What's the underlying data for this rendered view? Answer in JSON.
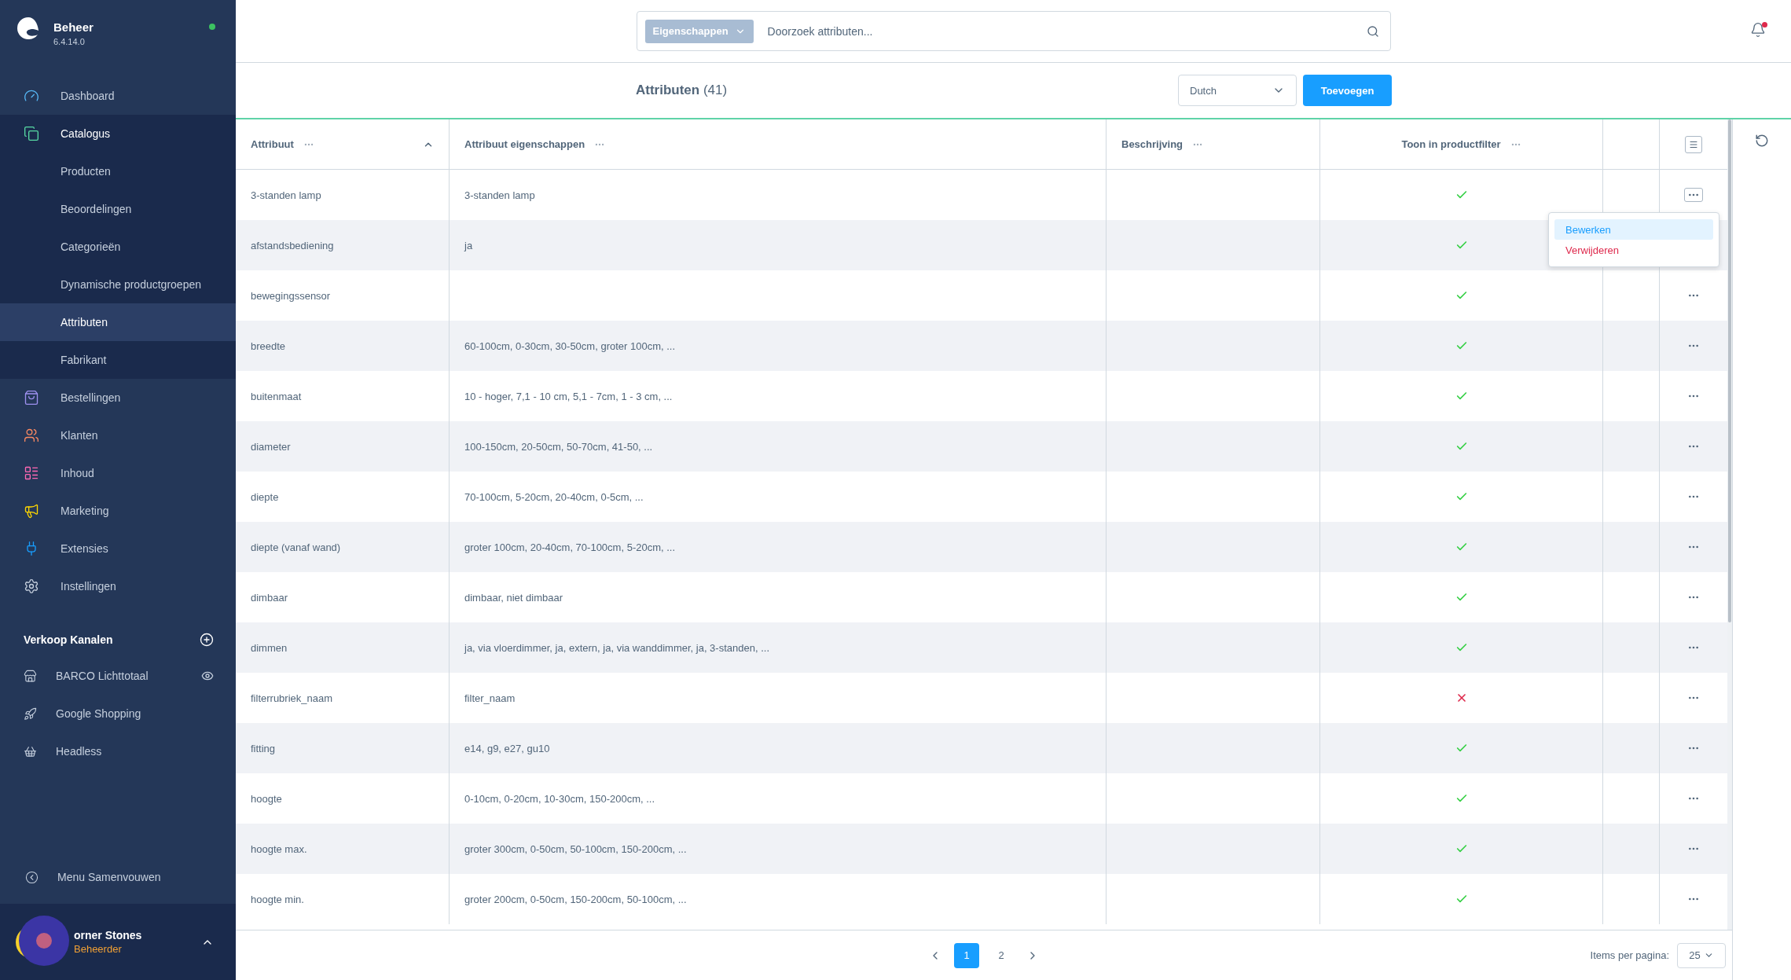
{
  "sidebar": {
    "brand": {
      "title": "Beheer",
      "version": "6.4.14.0",
      "online": true
    },
    "nav": [
      {
        "label": "Dashboard",
        "expanded": false
      },
      {
        "label": "Catalogus",
        "expanded": true,
        "children": [
          {
            "label": "Producten",
            "selected": false
          },
          {
            "label": "Beoordelingen",
            "selected": false
          },
          {
            "label": "Categorieën",
            "selected": false
          },
          {
            "label": "Dynamische productgroepen",
            "selected": false
          },
          {
            "label": "Attributen",
            "selected": true
          },
          {
            "label": "Fabrikant",
            "selected": false
          }
        ]
      },
      {
        "label": "Bestellingen",
        "expanded": false
      },
      {
        "label": "Klanten",
        "expanded": false
      },
      {
        "label": "Inhoud",
        "expanded": false
      },
      {
        "label": "Marketing",
        "expanded": false
      },
      {
        "label": "Extensies",
        "expanded": false
      },
      {
        "label": "Instellingen",
        "expanded": false
      }
    ],
    "sales_channels": {
      "title": "Verkoop Kanalen",
      "items": [
        {
          "label": "BARCO Lichttotaal"
        },
        {
          "label": "Google Shopping"
        },
        {
          "label": "Headless"
        }
      ]
    },
    "collapse": "Menu Samenvouwen",
    "user": {
      "name": "orner Stones",
      "role": "Beheerder"
    }
  },
  "topbar": {
    "search": {
      "category": "Eigenschappen",
      "placeholder": "Doorzoek attributen..."
    },
    "notification": {
      "unread": true
    }
  },
  "header": {
    "title": "Attributen",
    "count": "(41)",
    "language": "Dutch",
    "add_button": "Toevoegen"
  },
  "table": {
    "columns": [
      {
        "label": "Attribuut",
        "sorted": true
      },
      {
        "label": "Attribuut eigenschappen"
      },
      {
        "label": "Beschrijving"
      },
      {
        "label": "Toon in productfilter"
      }
    ],
    "rows": [
      {
        "name": "3-standen lamp",
        "properties": "3-standen lamp",
        "in_filter": true,
        "menu_open": true
      },
      {
        "name": "afstandsbediening",
        "properties": "ja",
        "in_filter": true,
        "menu_open": false
      },
      {
        "name": "bewegingssensor",
        "in_filter": true,
        "menu_open": false
      },
      {
        "name": "breedte",
        "properties": "60-100cm, 0-30cm, 30-50cm, groter 100cm, ...",
        "in_filter": true,
        "menu_open": false
      },
      {
        "name": "buitenmaat",
        "properties": "10 - hoger, 7,1 - 10 cm, 5,1 - 7cm, 1 - 3 cm, ...",
        "in_filter": true,
        "menu_open": false
      },
      {
        "name": "diameter",
        "properties": "100-150cm, 20-50cm, 50-70cm, 41-50, ...",
        "in_filter": true,
        "menu_open": false
      },
      {
        "name": "diepte",
        "properties": "70-100cm, 5-20cm, 20-40cm, 0-5cm, ...",
        "in_filter": true,
        "menu_open": false
      },
      {
        "name": "diepte (vanaf wand)",
        "properties": "groter 100cm, 20-40cm, 70-100cm, 5-20cm, ...",
        "in_filter": true,
        "menu_open": false
      },
      {
        "name": "dimbaar",
        "properties": "dimbaar, niet dimbaar",
        "in_filter": true,
        "menu_open": false
      },
      {
        "name": "dimmen",
        "properties": "ja, via vloerdimmer, ja, extern, ja, via wanddimmer, ja, 3-standen, ...",
        "in_filter": true,
        "menu_open": false
      },
      {
        "name": "filterrubriek_naam",
        "properties": "filter_naam",
        "in_filter": false,
        "menu_open": false
      },
      {
        "name": "fitting",
        "properties": "e14, g9, e27, gu10",
        "in_filter": true,
        "menu_open": false
      },
      {
        "name": "hoogte",
        "properties": "0-10cm, 0-20cm, 10-30cm, 150-200cm, ...",
        "in_filter": true,
        "menu_open": false
      },
      {
        "name": "hoogte max.",
        "properties": "groter 300cm, 0-50cm, 50-100cm, 150-200cm, ...",
        "in_filter": true,
        "menu_open": false
      },
      {
        "name": "hoogte min.",
        "properties": "groter 200cm, 0-50cm, 150-200cm, 50-100cm, ...",
        "in_filter": true,
        "menu_open": false
      }
    ],
    "row_menu": {
      "items": [
        {
          "label": "Bewerken",
          "kind": "edit",
          "highlighted": true
        },
        {
          "label": "Verwijderen",
          "kind": "danger",
          "highlighted": false
        }
      ]
    }
  },
  "pagination": {
    "pages": [
      {
        "label": "1",
        "selected": true
      },
      {
        "label": "2",
        "selected": false
      }
    ],
    "per_page_label": "Items per pagina:",
    "per_page": "25"
  }
}
